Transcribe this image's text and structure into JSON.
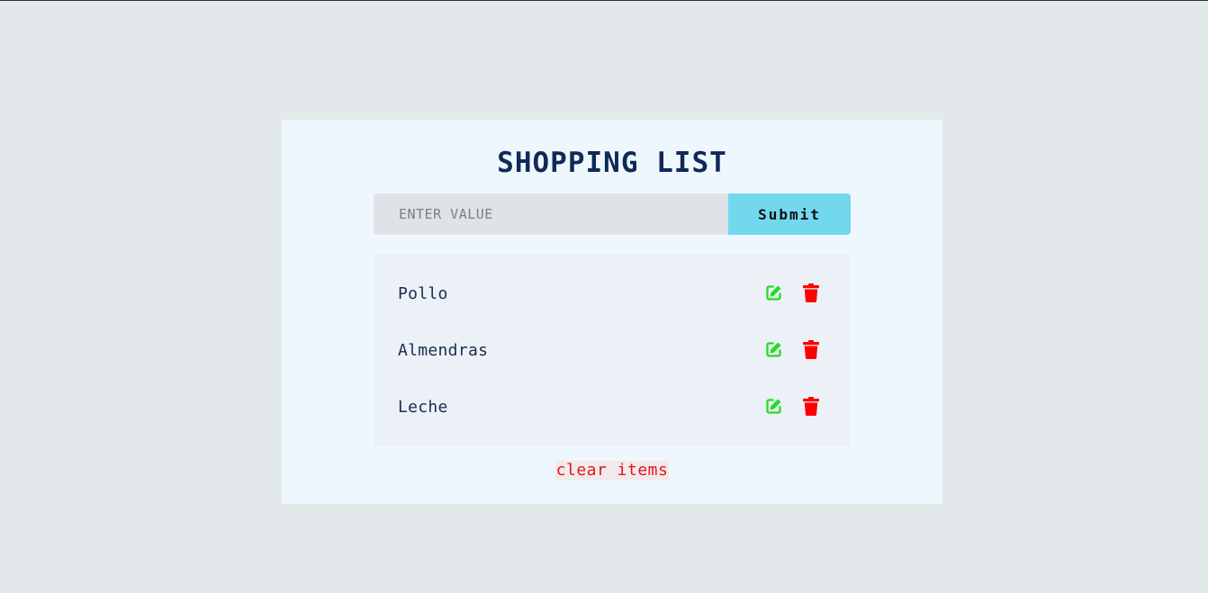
{
  "app": {
    "title": "SHOPPING LIST"
  },
  "form": {
    "input_value": "",
    "input_placeholder": "ENTER VALUE",
    "submit_label": "Submit"
  },
  "list": {
    "items": [
      {
        "name": "Pollo"
      },
      {
        "name": "Almendras"
      },
      {
        "name": "Leche"
      }
    ]
  },
  "footer": {
    "clear_label": "clear items"
  },
  "icons": {
    "edit": "edit-icon",
    "delete": "trash-icon"
  },
  "colors": {
    "title": "#102a57",
    "submit_bg": "#72d8ee",
    "edit_icon": "#22dd22",
    "delete_icon": "#ff0000",
    "clear_text": "#e4151b"
  }
}
